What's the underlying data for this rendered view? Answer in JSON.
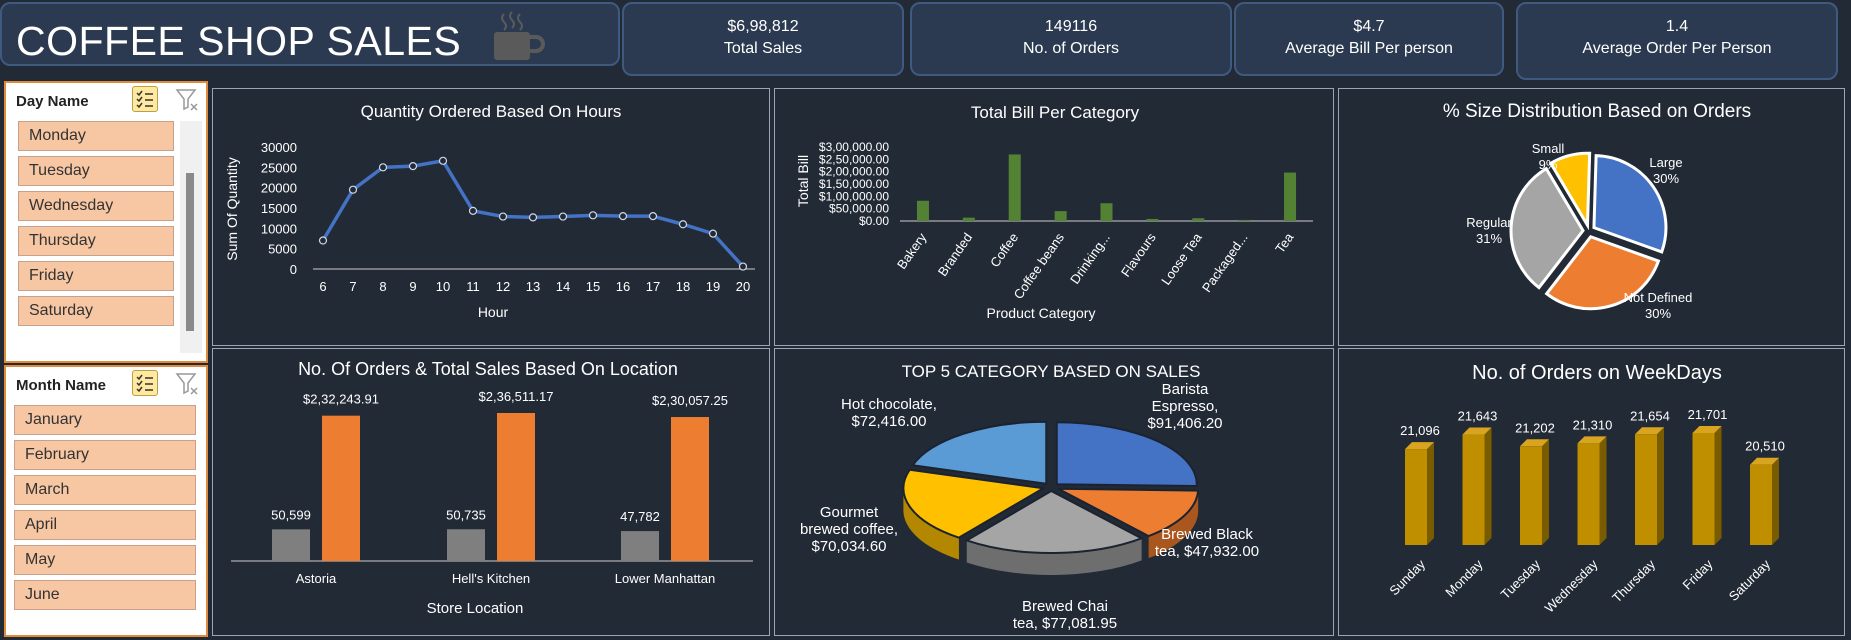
{
  "header": {
    "title": "COFFEE SHOP SALES",
    "icon": "coffee-cup-icon"
  },
  "kpis": [
    {
      "value": "$6,98,812",
      "label": "Total Sales"
    },
    {
      "value": "149116",
      "label": "No. of Orders"
    },
    {
      "value": "$4.7",
      "label": "Average Bill Per person"
    },
    {
      "value": "1.4",
      "label": "Average Order Per Person"
    }
  ],
  "slicers": {
    "day": {
      "title": "Day Name",
      "items": [
        "Monday",
        "Tuesday",
        "Wednesday",
        "Thursday",
        "Friday",
        "Saturday"
      ]
    },
    "month": {
      "title": "Month Name",
      "items": [
        "January",
        "February",
        "March",
        "April",
        "May",
        "June"
      ]
    }
  },
  "colors": {
    "line": "#4472c4",
    "bar_green": "#548235",
    "orange": "#ed7d31",
    "gray": "#7f7f7f",
    "blue": "#4472c4",
    "yellow": "#ffc000",
    "light_gray": "#a5a5a5",
    "light_blue": "#5b9bd5",
    "gold": "#bf8f00"
  },
  "chart_data": [
    {
      "type": "line",
      "title": "Quantity Ordered Based On Hours",
      "xlabel": "Hour",
      "ylabel": "Sum Of Quantity",
      "x": [
        6,
        7,
        8,
        9,
        10,
        11,
        12,
        13,
        14,
        15,
        16,
        17,
        18,
        19,
        20
      ],
      "values": [
        7000,
        19500,
        25000,
        25300,
        26600,
        14300,
        12900,
        12700,
        12900,
        13200,
        13000,
        13000,
        11000,
        8700,
        600
      ],
      "yticks": [
        "0",
        "5000",
        "10000",
        "15000",
        "20000",
        "25000",
        "30000"
      ],
      "ylim": [
        0,
        30000
      ]
    },
    {
      "type": "bar",
      "title": "Total Bill Per Category",
      "xlabel": "Product Category",
      "ylabel": "Total Bill",
      "categories": [
        "Bakery",
        "Branded",
        "Coffee",
        "Coffee beans",
        "Drinking...",
        "Flavours",
        "Loose Tea",
        "Packaged...",
        "Tea"
      ],
      "values": [
        82000,
        13600,
        269900,
        40000,
        72000,
        8400,
        11200,
        4400,
        196400
      ],
      "yticks": [
        "$0.00",
        "$50,000.00",
        "$1,00,000.00",
        "$1,50,000.00",
        "$2,00,000.00",
        "$2,50,000.00",
        "$3,00,000.00"
      ],
      "ylim": [
        0,
        300000
      ]
    },
    {
      "type": "pie",
      "title": "% Size Distribution Based on Orders",
      "slices": [
        {
          "label": "Large",
          "pct_label": "30%",
          "value": 30
        },
        {
          "label": "Not Defined",
          "pct_label": "30%",
          "value": 30
        },
        {
          "label": "Regular",
          "pct_label": "31%",
          "value": 31
        },
        {
          "label": "Small",
          "pct_label": "9%",
          "value": 9
        }
      ]
    },
    {
      "type": "bar",
      "title": "No. Of Orders & Total Sales Based On Location",
      "xlabel": "Store Location",
      "categories": [
        "Astoria",
        "Hell's Kitchen",
        "Lower Manhattan"
      ],
      "series": [
        {
          "values": [
            50599,
            50735,
            47782
          ],
          "labels": [
            "50,599",
            "50,735",
            "47,782"
          ]
        },
        {
          "values": [
            232243.91,
            236511.17,
            230057.25
          ],
          "labels": [
            "$2,32,243.91",
            "$2,36,511.17",
            "$2,30,057.25"
          ]
        }
      ]
    },
    {
      "type": "pie",
      "title": "TOP 5 CATEGORY BASED ON SALES",
      "slices": [
        {
          "label": "Barista Espresso, $91,406.20",
          "value": 91406.2
        },
        {
          "label": "Brewed Black tea, $47,932.00",
          "value": 47932.0
        },
        {
          "label": "Brewed Chai tea, $77,081.95",
          "value": 77081.95
        },
        {
          "label": "Gourmet brewed coffee, $70,034.60",
          "value": 70034.6
        },
        {
          "label": "Hot chocolate, $72,416.00",
          "value": 72416.0
        }
      ],
      "label_lines": {
        "barista": [
          "Barista",
          "Espresso,",
          "$91,406.20"
        ],
        "black": [
          "Brewed Black",
          "tea, $47,932.00"
        ],
        "chai": [
          "Brewed Chai",
          "tea, $77,081.95"
        ],
        "gourmet": [
          "Gourmet",
          "brewed coffee,",
          "$70,034.60"
        ],
        "hotchoc": [
          "Hot chocolate,",
          "$72,416.00"
        ]
      }
    },
    {
      "type": "bar",
      "title": "No. of Orders on WeekDays",
      "categories": [
        "Sunday",
        "Monday",
        "Tuesday",
        "Wednesday",
        "Thursday",
        "Friday",
        "Saturday"
      ],
      "values": [
        21096,
        21643,
        21202,
        21310,
        21654,
        21701,
        20510
      ],
      "labels": [
        "21,096",
        "21,643",
        "21,202",
        "21,310",
        "21,654",
        "21,701",
        "20,510"
      ]
    }
  ]
}
